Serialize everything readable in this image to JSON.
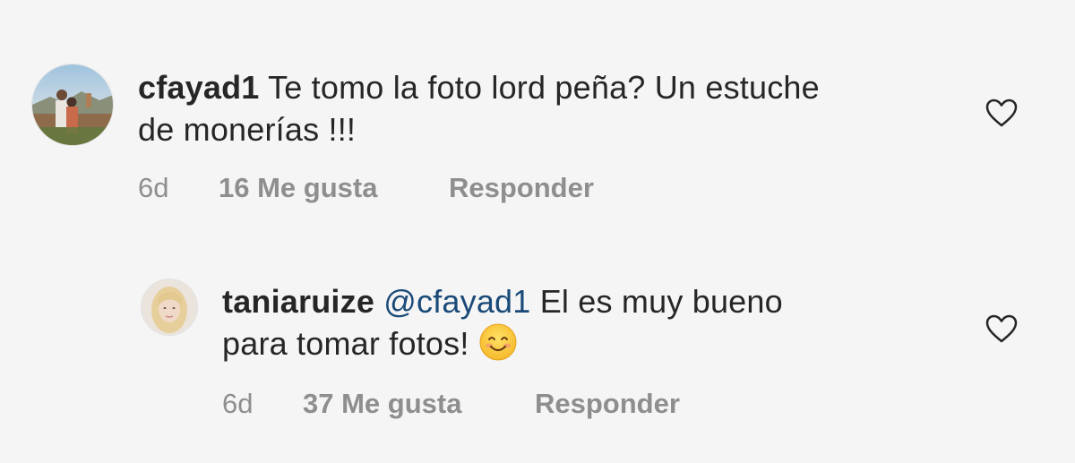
{
  "comments": [
    {
      "username": "cfayad1",
      "mention": "",
      "line1": "Te tomo la foto lord peña? Un estuche",
      "line2": "de monerías !!!",
      "age": "6d",
      "likes": "16 Me gusta",
      "reply": "Responder",
      "avatar_icon": "avatar-couple-photo"
    },
    {
      "username": "taniaruize",
      "mention": "@cfayad1",
      "line1": "El es muy bueno",
      "line2": "para tomar fotos!",
      "age": "6d",
      "likes": "37 Me gusta",
      "reply": "Responder",
      "avatar_icon": "avatar-blonde-woman"
    }
  ],
  "colors": {
    "background": "#f5f5f5",
    "text": "#262626",
    "meta": "#8e8e8e",
    "mention": "#1a4a78"
  },
  "icons": [
    "heart-outline-icon",
    "smiling-face-emoji"
  ]
}
